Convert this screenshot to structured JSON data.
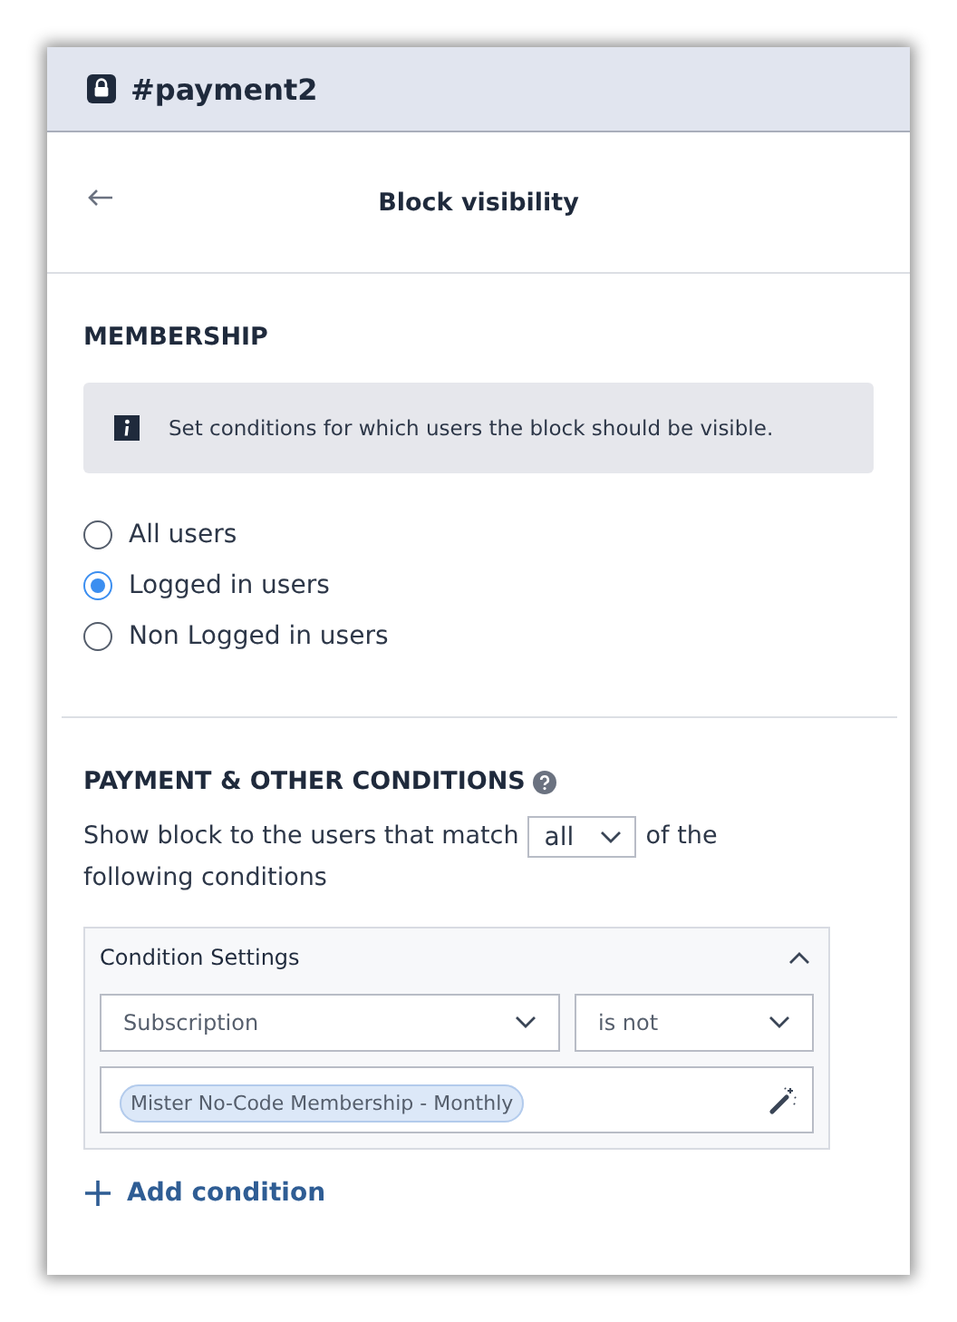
{
  "header": {
    "title": "#payment2"
  },
  "subheader": {
    "title": "Block visibility"
  },
  "membership": {
    "heading": "MEMBERSHIP",
    "info": "Set conditions for which users the block should be visible.",
    "options": [
      {
        "label": "All users",
        "selected": false
      },
      {
        "label": "Logged in users",
        "selected": true
      },
      {
        "label": "Non Logged in users",
        "selected": false
      }
    ]
  },
  "conditions": {
    "heading": "PAYMENT & OTHER CONDITIONS",
    "sentence_start": "Show block to the users that match",
    "match": "all",
    "sentence_end": "of the",
    "sentence_continued": "following conditions",
    "card": {
      "title": "Condition Settings",
      "expanded": true,
      "field": "Subscription",
      "operator": "is not",
      "tags": [
        "Mister No-Code Membership - Monthly"
      ]
    },
    "add_label": "Add condition"
  }
}
